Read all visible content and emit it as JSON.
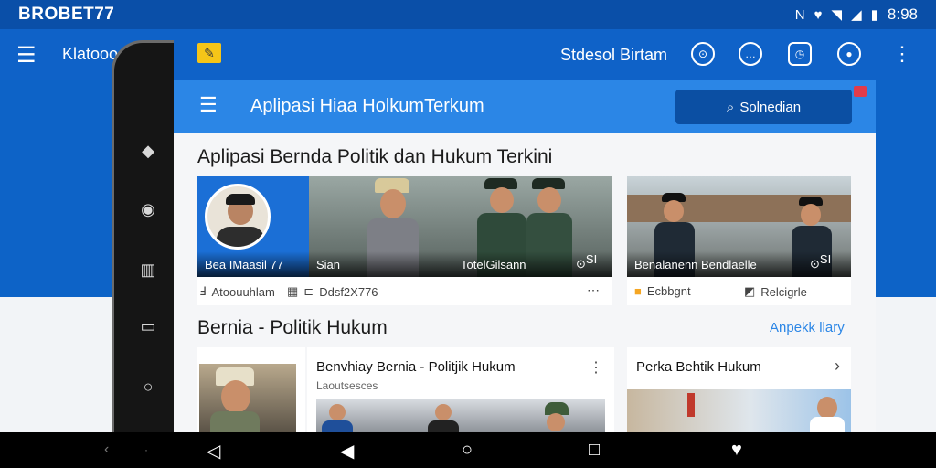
{
  "status_bar": {
    "brand": "BROBET77",
    "time": "8:98",
    "nfc": "N"
  },
  "outer_bar": {
    "title": "Klatooocm"
  },
  "screen": {
    "title": "Stdesol Birtam",
    "header_title": "Aplipasi Hiaa HolkumTerkum",
    "search_label": "Solnedian"
  },
  "featured": {
    "title": "Aplipasi Bernda Politik dan Hukum Terkini",
    "card1": {
      "profile_caption": "Bea IMaasil 77",
      "caption_mid": "Sian",
      "caption_right": "TotelGilsann",
      "duration": "SI",
      "meta_left": "Atoouuhlam",
      "meta_right": "Ddsf2X776"
    },
    "card2": {
      "caption": "Benalanenn Bendlaelle",
      "duration": "SI",
      "meta_left": "Ecbbgnt",
      "meta_right": "Relcigrle"
    }
  },
  "news": {
    "title": "Bernia - Politik Hukum",
    "see_all": "Anpekk llary",
    "card1": {
      "title": "Benvhiay Bernia - Politjik Hukum",
      "subtitle": "Laoutsesces"
    },
    "card2": {
      "title": "Perka Behtik Hukum"
    }
  },
  "colors": {
    "primary": "#0f62c8",
    "header": "#2b86e6",
    "search": "#0b4fa3",
    "accent_badge": "#e23b4a"
  }
}
